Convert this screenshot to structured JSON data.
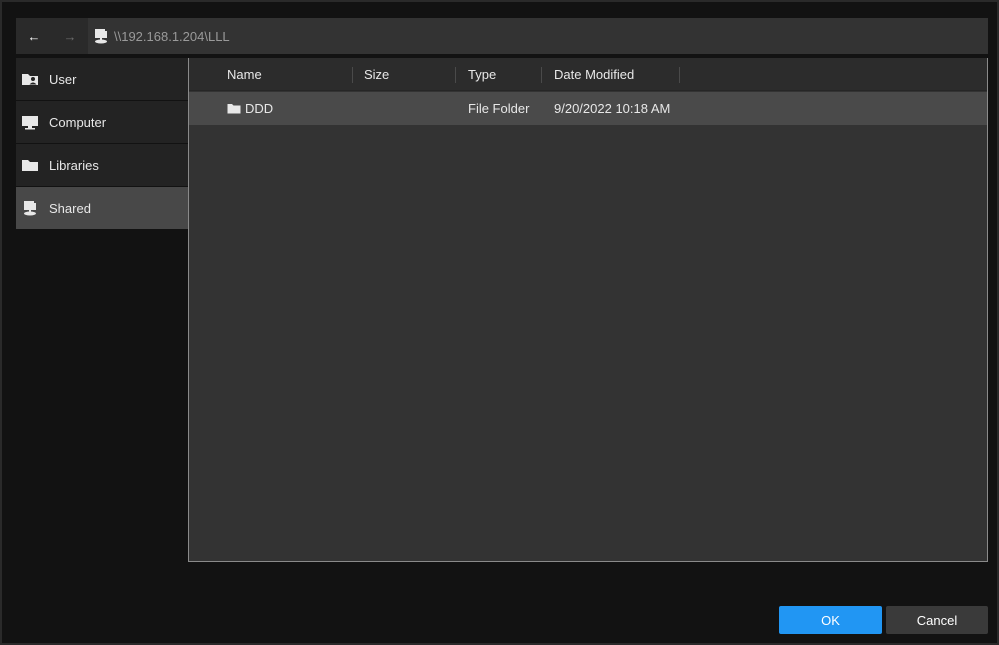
{
  "nav": {
    "back_glyph": "←",
    "forward_glyph": "→",
    "path": "\\\\192.168.1.204\\LLL"
  },
  "sidebar": {
    "items": [
      {
        "label": "User",
        "icon": "user-folder-icon"
      },
      {
        "label": "Computer",
        "icon": "monitor-icon"
      },
      {
        "label": "Libraries",
        "icon": "folder-icon"
      },
      {
        "label": "Shared",
        "icon": "network-share-icon",
        "active": true
      }
    ]
  },
  "filelist": {
    "columns": [
      "Name",
      "Size",
      "Type",
      "Date Modified"
    ],
    "rows": [
      {
        "name": "DDD",
        "size": "",
        "type": "File Folder",
        "date_modified": "9/20/2022 10:18 AM",
        "icon": "folder-icon"
      }
    ]
  },
  "buttons": {
    "ok": "OK",
    "cancel": "Cancel"
  },
  "colors": {
    "accent": "#2196f3",
    "selected_row": "#4a4a4a",
    "active_sidebar": "#484848"
  }
}
